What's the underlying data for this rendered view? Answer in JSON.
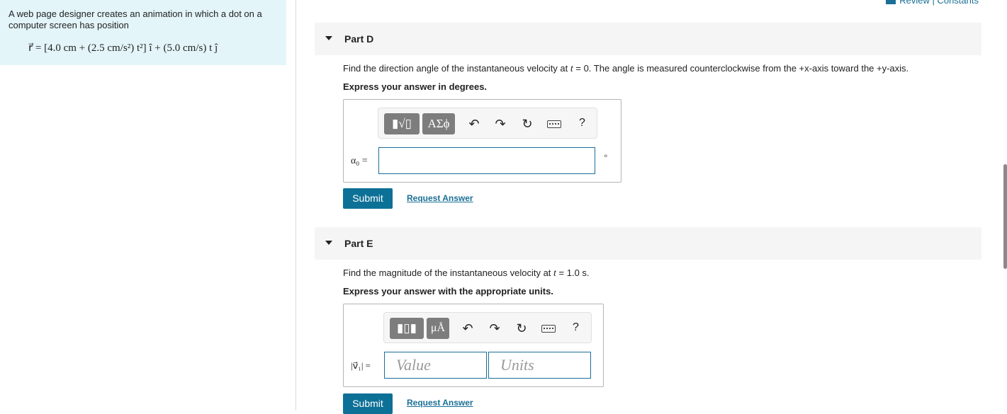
{
  "problem": {
    "text": "A web page designer creates an animation in which a dot on a computer screen has position",
    "equation": "r⃗ = [4.0 cm + (2.5 cm/s²) t²] î + (5.0 cm/s) t ĵ"
  },
  "header": {
    "review_constants": "Review | Constants"
  },
  "partD": {
    "title": "Part D",
    "prompt_before": "Find the direction angle of the instantaneous velocity at ",
    "prompt_var": "t",
    "prompt_after": " = 0. The angle is measured counterclockwise from the +x-axis toward the +y-axis.",
    "instruction": "Express your answer in degrees.",
    "toolbar": {
      "template_btn": "▮√▯",
      "greek_btn": "ΑΣϕ",
      "help": "?"
    },
    "var_label": "α₀ =",
    "input_value": "",
    "unit": "∘",
    "submit": "Submit",
    "request": "Request Answer"
  },
  "partE": {
    "title": "Part E",
    "prompt_before": "Find the magnitude of the instantaneous velocity at ",
    "prompt_var": "t",
    "prompt_after": " = 1.0 s.",
    "instruction": "Express your answer with the appropriate units.",
    "toolbar": {
      "template_btn": "▮▯▮",
      "units_btn": "μÅ",
      "help": "?"
    },
    "var_label": "|v⃗₁| =",
    "value_placeholder": "Value",
    "units_placeholder": "Units",
    "submit": "Submit",
    "request": "Request Answer"
  }
}
